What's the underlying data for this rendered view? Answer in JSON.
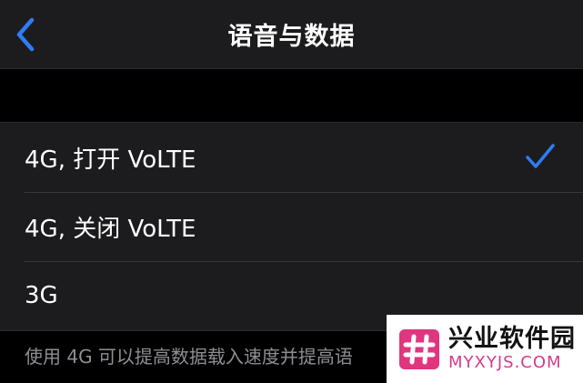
{
  "nav": {
    "title": "语音与数据",
    "back_icon": "chevron-left-icon",
    "accent_color": "#2f7cf6"
  },
  "options": [
    {
      "label": "4G, 打开 VoLTE",
      "selected": true
    },
    {
      "label": "4G, 关闭 VoLTE",
      "selected": false
    },
    {
      "label": "3G",
      "selected": false
    }
  ],
  "footer": {
    "text": "使用 4G 可以提高数据载入速度并提高语"
  },
  "watermark": {
    "name": "兴业软件园",
    "url": "MYXYJS.COM",
    "logo_icon": "hash-logo-icon"
  }
}
